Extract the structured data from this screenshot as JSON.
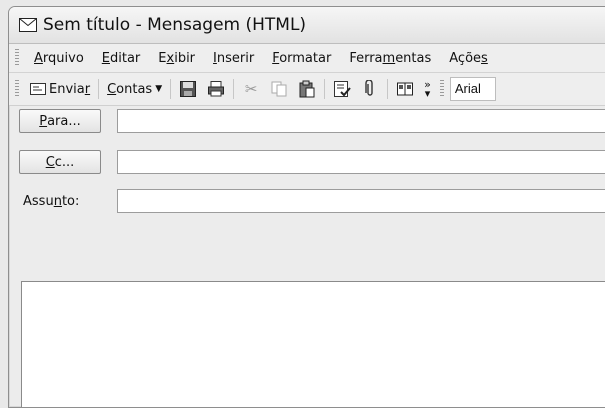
{
  "window": {
    "title": "Sem título - Mensagem (HTML)",
    "icon": "envelope-icon"
  },
  "menu": {
    "items": [
      {
        "label": "Arquivo",
        "accel_index": 0
      },
      {
        "label": "Editar",
        "accel_index": 0
      },
      {
        "label": "Exibir",
        "accel_index": 1
      },
      {
        "label": "Inserir",
        "accel_index": 0
      },
      {
        "label": "Formatar",
        "accel_index": 0
      },
      {
        "label": "Ferramentas",
        "accel_index": 5
      },
      {
        "label": "Ações",
        "accel_index": 4
      }
    ]
  },
  "toolbar": {
    "send_label": "Enviar",
    "accounts_label": "Contas",
    "font_value": "Arial",
    "icons": [
      "save-icon",
      "print-icon",
      "cut-icon",
      "copy-icon",
      "paste-icon",
      "check-names-icon",
      "attach-icon",
      "address-book-icon",
      "more-icon"
    ]
  },
  "fields": {
    "to_label": "Para...",
    "cc_label": "Cc...",
    "subject_label": "Assunto:",
    "to_value": "",
    "cc_value": "",
    "subject_value": ""
  },
  "message": {
    "body": ""
  }
}
